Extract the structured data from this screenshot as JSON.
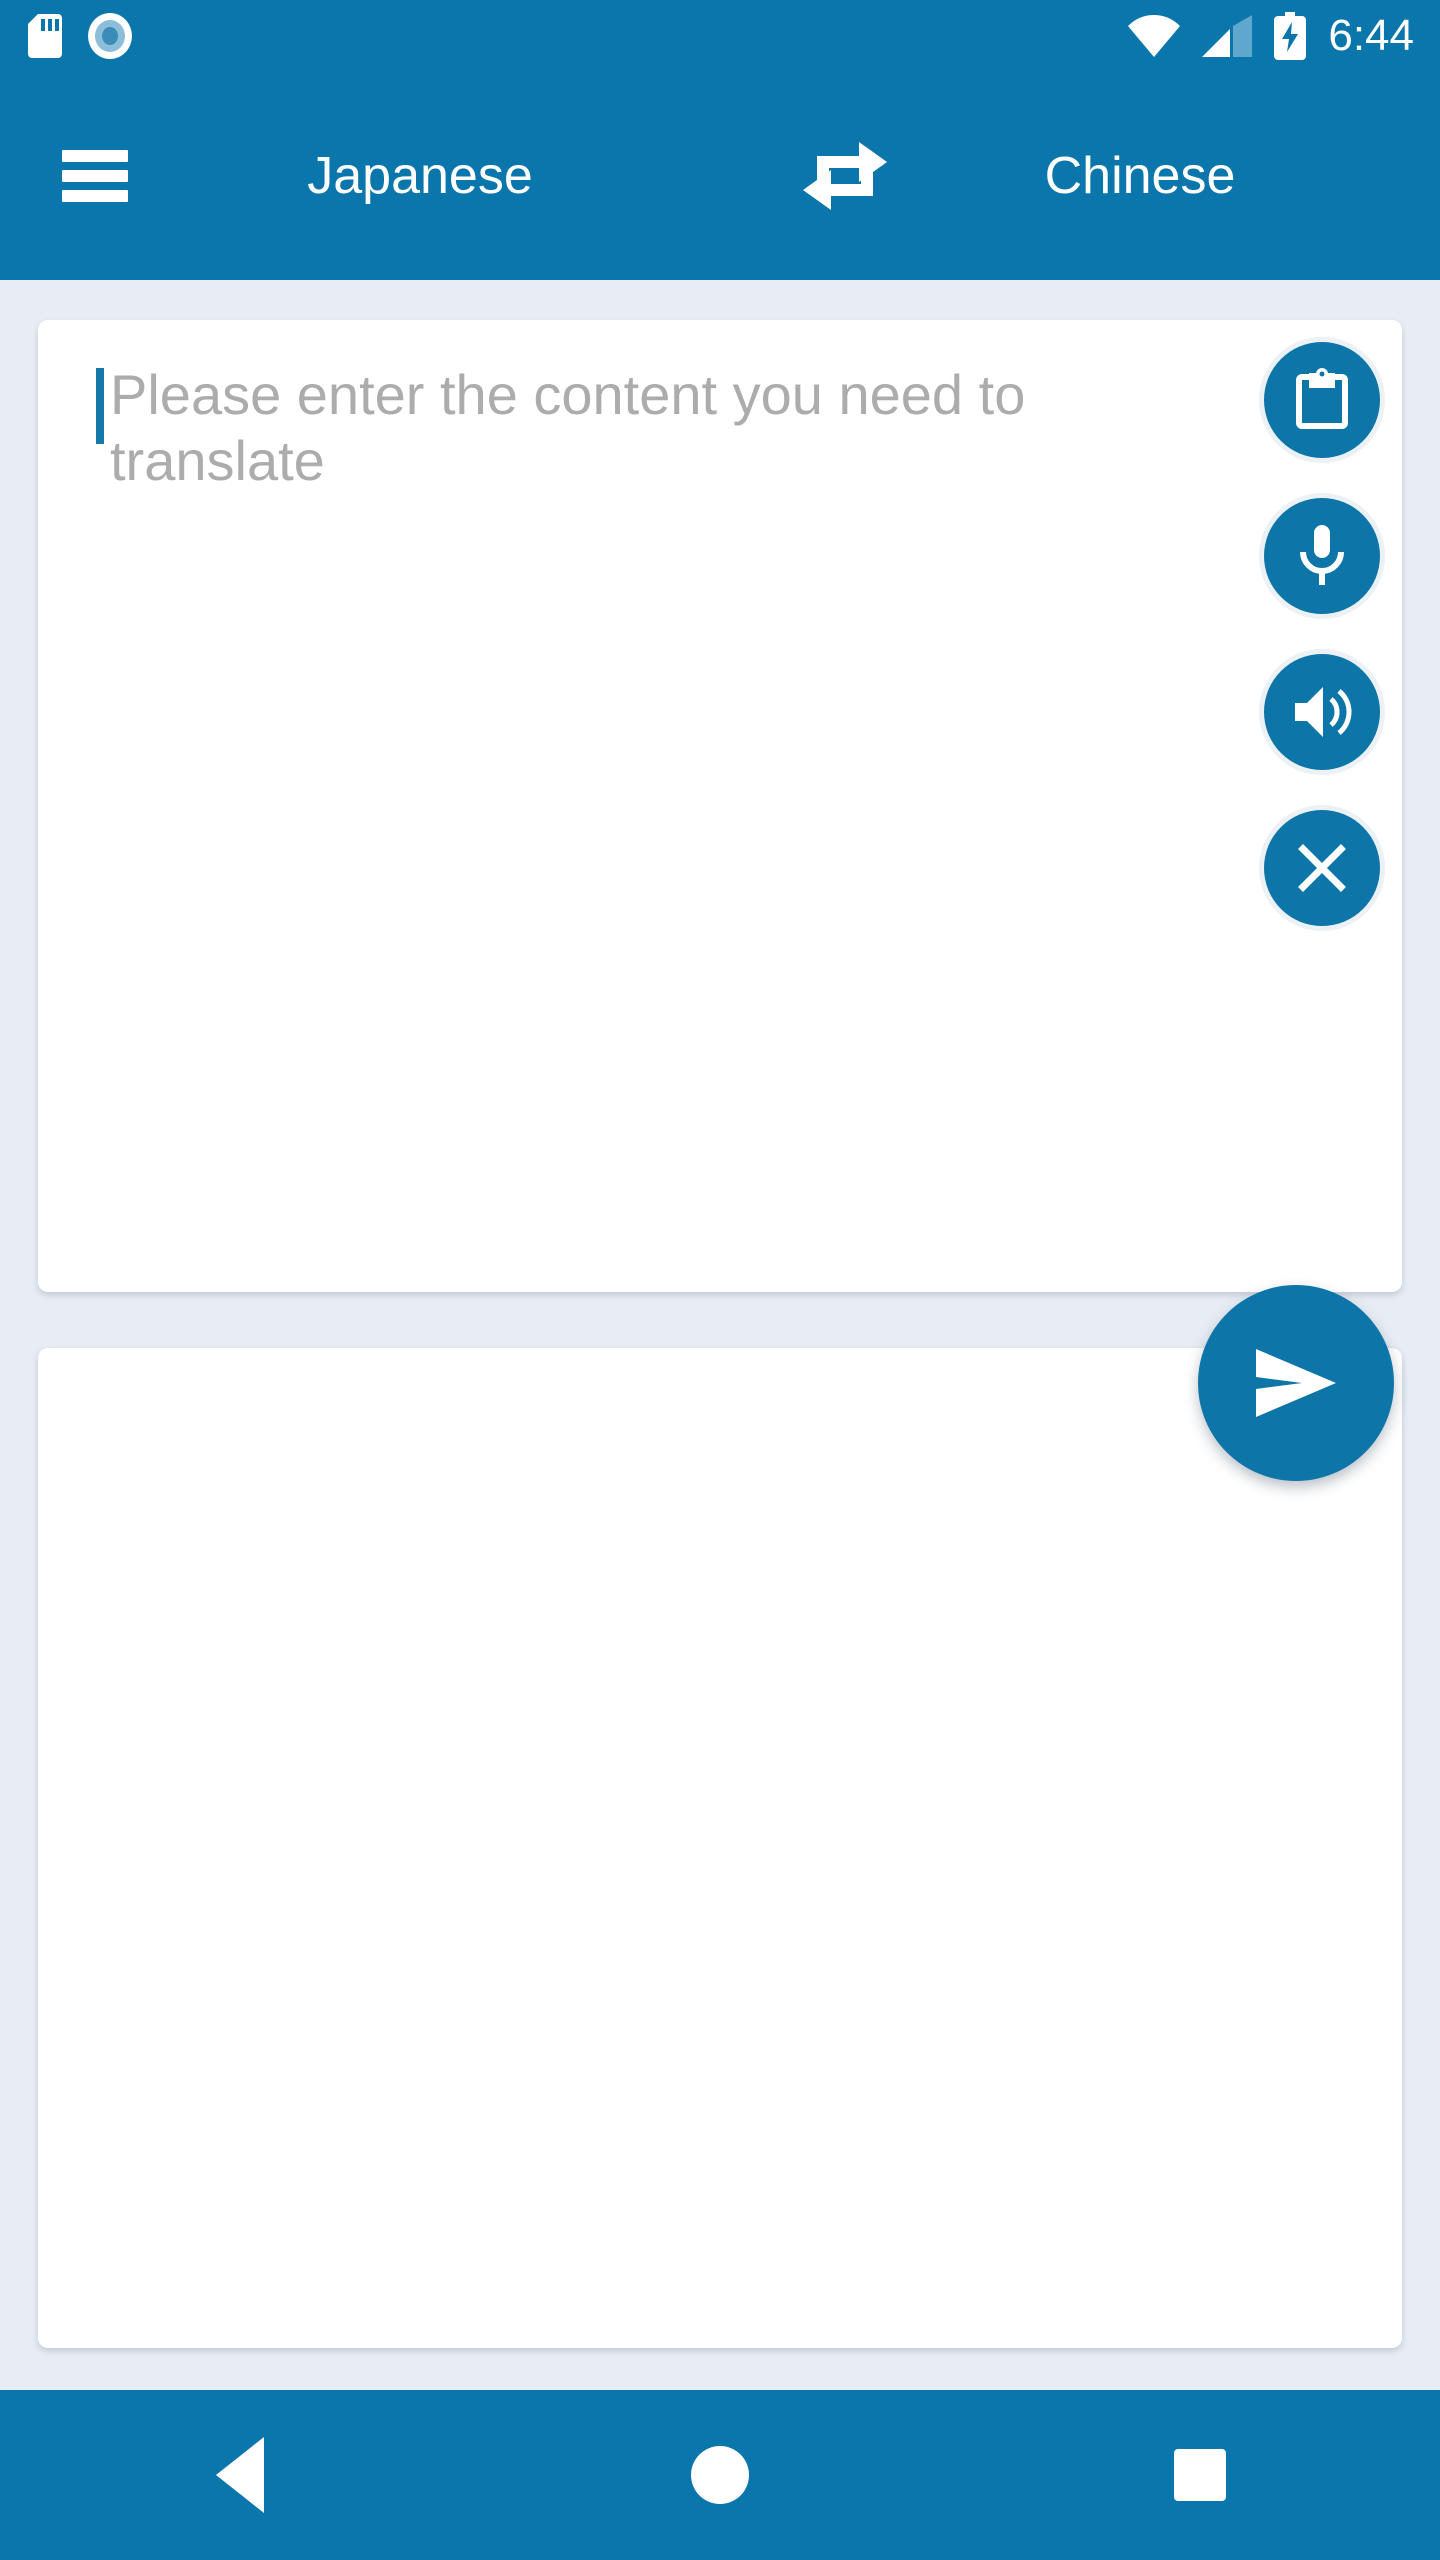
{
  "status_bar": {
    "time": "6:44",
    "icons": [
      {
        "name": "sd-card-icon"
      },
      {
        "name": "screen-record-icon"
      },
      {
        "name": "wifi-icon"
      },
      {
        "name": "cellular-signal-icon"
      },
      {
        "name": "battery-charging-icon"
      }
    ]
  },
  "app_bar": {
    "menu_icon": "hamburger-menu-icon",
    "source_language": "Japanese",
    "swap_icon": "swap-languages-icon",
    "target_language": "Chinese",
    "background_color": "#0B76AC"
  },
  "input_card": {
    "placeholder": "Please enter the content you need to translate",
    "value": "",
    "caret_color": "#1579A8",
    "actions": [
      {
        "name": "paste-button",
        "icon": "clipboard-icon",
        "label": "Paste"
      },
      {
        "name": "voice-input-button",
        "icon": "microphone-icon",
        "label": "Voice input"
      },
      {
        "name": "speak-button",
        "icon": "speaker-icon",
        "label": "Speak"
      },
      {
        "name": "clear-button",
        "icon": "close-icon",
        "label": "Clear"
      }
    ]
  },
  "output_card": {
    "value": "",
    "placeholder": ""
  },
  "send_button": {
    "icon": "send-icon",
    "label": "Translate",
    "color": "#0E75A8"
  },
  "nav_bar": {
    "buttons": [
      {
        "name": "nav-back-button",
        "icon": "back-triangle-icon",
        "label": "Back"
      },
      {
        "name": "nav-home-button",
        "icon": "home-circle-icon",
        "label": "Home"
      },
      {
        "name": "nav-recents-button",
        "icon": "recents-square-icon",
        "label": "Recents"
      }
    ]
  },
  "theme": {
    "primary": "#0B76AC",
    "accent": "#0E75A8",
    "background": "#E8EDF5",
    "card": "#FFFFFF",
    "placeholder_text": "#ACACAC"
  }
}
